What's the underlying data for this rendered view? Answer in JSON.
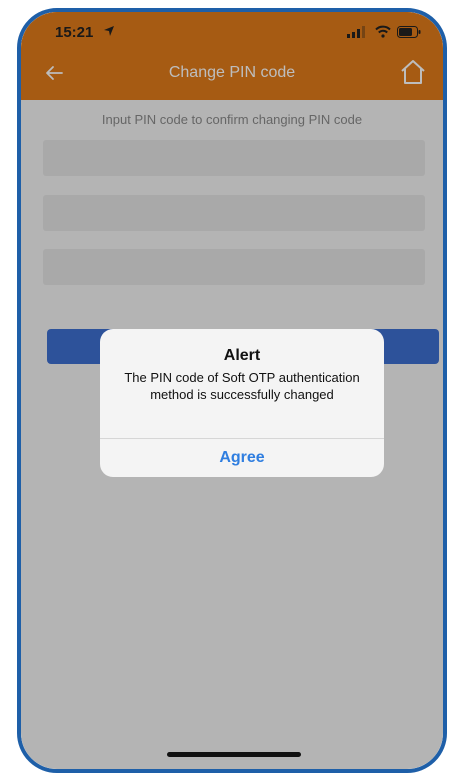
{
  "status_bar": {
    "time": "15:21"
  },
  "nav": {
    "title": "Change PIN code",
    "back_icon": "back-arrow-icon",
    "home_icon": "home-icon"
  },
  "form": {
    "instruction": "Input PIN code to confirm changing PIN code",
    "fields": [
      {
        "value": ""
      },
      {
        "value": ""
      },
      {
        "value": ""
      }
    ]
  },
  "alert": {
    "title": "Alert",
    "message": "The PIN code of Soft OTP authentication method is successfully changed",
    "button": "Agree"
  },
  "colors": {
    "header": "#e07b1a",
    "primary_button": "#3d6fd0",
    "alert_button_text": "#2f7ee0",
    "device_frame": "#1e5fa8"
  }
}
